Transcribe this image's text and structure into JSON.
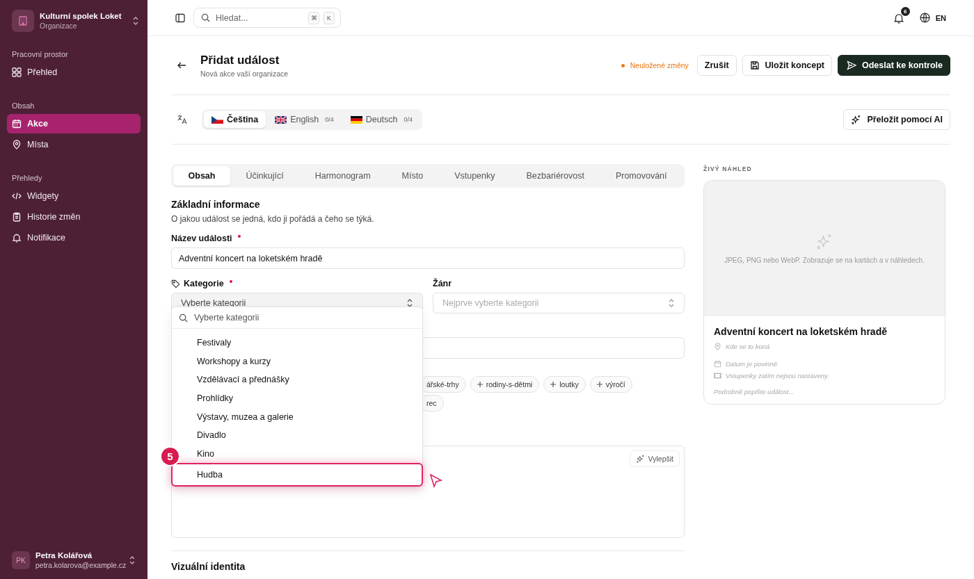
{
  "sidebar": {
    "org": {
      "name": "Kulturní spolek Loket",
      "subtitle": "Organizace"
    },
    "sections": [
      {
        "title": "Pracovní prostor",
        "items": [
          {
            "label": "Přehled",
            "selected": false
          }
        ]
      },
      {
        "title": "Obsah",
        "items": [
          {
            "label": "Akce",
            "selected": true
          },
          {
            "label": "Místa",
            "selected": false
          }
        ]
      },
      {
        "title": "Přehledy",
        "items": [
          {
            "label": "Widgety",
            "selected": false
          },
          {
            "label": "Historie změn",
            "selected": false
          },
          {
            "label": "Notifikace",
            "selected": false
          }
        ]
      }
    ],
    "user": {
      "initials": "PK",
      "name": "Petra Kolářová",
      "email": "petra.kolarova@example.cz"
    }
  },
  "topbar": {
    "search": {
      "placeholder": "Hledat...",
      "keys": [
        "⌘",
        "K"
      ]
    },
    "notification_count": "6",
    "language": "EN"
  },
  "header": {
    "title": "Přidat událost",
    "subtitle": "Nová akce vaší organizace",
    "unsaved": "Neuložené změny",
    "buttons": [
      {
        "label": "Zrušit",
        "kind": "plain"
      },
      {
        "label": "Uložit koncept",
        "kind": "save"
      },
      {
        "label": "Odeslat ke kontrole",
        "kind": "send"
      }
    ]
  },
  "languages": [
    {
      "label": "Čeština",
      "selected": true
    },
    {
      "label": "English",
      "count": "0/4",
      "selected": false
    },
    {
      "label": "Deutsch",
      "count": "0/4",
      "selected": false
    }
  ],
  "translate_button": "Přeložit pomocí AI",
  "tabs": [
    {
      "label": "Obsah",
      "selected": true
    },
    {
      "label": "Účinkující",
      "selected": false
    },
    {
      "label": "Harmonogram",
      "selected": false
    },
    {
      "label": "Místo",
      "selected": false
    },
    {
      "label": "Vstupenky",
      "selected": false
    },
    {
      "label": "Bezbariérovost",
      "selected": false
    },
    {
      "label": "Promovování",
      "selected": false
    }
  ],
  "section": {
    "title": "Základní informace",
    "description": "O jakou událost se jedná, kdo ji pořádá a čeho se týká."
  },
  "name_field": {
    "label": "Název události",
    "required": true,
    "value": "Adventní koncert na loketském hradě"
  },
  "category_field": {
    "label": "Kategorie",
    "required": true,
    "placeholder": "Vyberte kategorii"
  },
  "genre_field": {
    "label": "Žánr",
    "placeholder": "Nejprve vyberte kategorii"
  },
  "tag_rows": [
    [
      {
        "label": "ářské-trhy",
        "plus": false
      },
      {
        "label": "rodiny-s-dětmi",
        "plus": true
      },
      {
        "label": "loutky",
        "plus": true
      },
      {
        "label": "výročí",
        "plus": true
      }
    ],
    [
      {
        "label": "rec",
        "plus": false
      }
    ]
  ],
  "enhance_button": "Vylepšit",
  "next_section": "Vizuální identita",
  "dropdown": {
    "search_placeholder": "Vyberte kategorii",
    "step_badge": "5",
    "options": [
      {
        "label": "Festivaly",
        "highlighted": false
      },
      {
        "label": "Workshopy a kurzy",
        "highlighted": false
      },
      {
        "label": "Vzdělávací a přednášky",
        "highlighted": false
      },
      {
        "label": "Prohlídky",
        "highlighted": false
      },
      {
        "label": "Výstavy, muzea a galerie",
        "highlighted": false
      },
      {
        "label": "Divadlo",
        "highlighted": false
      },
      {
        "label": "Kino",
        "highlighted": false
      },
      {
        "label": "Hudba",
        "highlighted": true
      }
    ]
  },
  "preview": {
    "heading": "ŽIVÝ NÁHLED",
    "image_hint": "JPEG, PNG nebo WebP. Zobrazuje se na kartách a v náhledech.",
    "title": "Adventní koncert na loketském hradě",
    "location": "Kde se to koná",
    "date": "Datum je povinné",
    "tickets": "Vstupenky zatím nejsou nastaveny.",
    "description": "Podrobně popište událost..."
  }
}
